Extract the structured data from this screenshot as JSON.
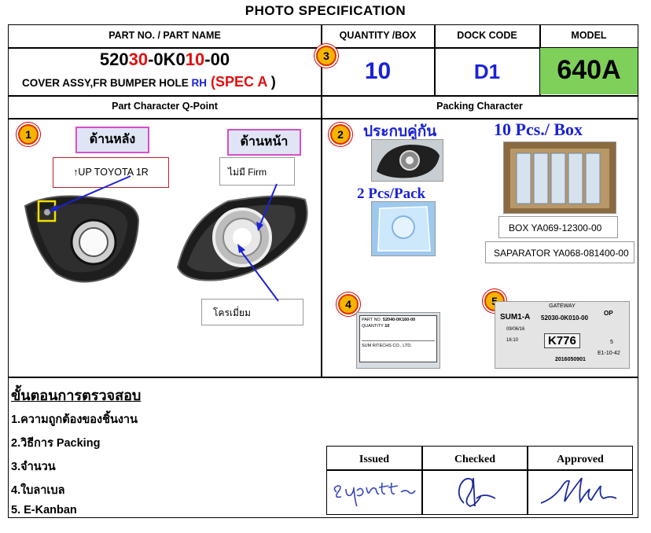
{
  "title": "PHOTO  SPECIFICATION",
  "header": {
    "part_label": "PART NO. / PART NAME",
    "qty_label": "QUANTITY /BOX",
    "dock_label": "DOCK CODE",
    "model_label": "MODEL"
  },
  "part": {
    "no_a": "520",
    "no_b": "30",
    "no_c": "-0K0",
    "no_d": "10",
    "no_e": "-00",
    "name": "COVER ASSY,FR BUMPER HOLE ",
    "side": "RH",
    "spec_open": " (",
    "spec": "SPEC A",
    "spec_close": " )"
  },
  "quantity": "10",
  "dock_code": "D1",
  "model": "640A",
  "model_bg": "#7ed05a",
  "sections": {
    "left": "Part Character Q-Point",
    "right": "Packing Character"
  },
  "badges": [
    "1",
    "2",
    "3",
    "4",
    "5"
  ],
  "q_point": {
    "back_label": "ด้านหลัง",
    "front_label": "ด้านหน้า",
    "note_up": "↑UP TOYOTA 1R",
    "note_firm": "ไม่มี Firm",
    "note_chrome": "โครเมี่ยม"
  },
  "packing": {
    "assembled": "ประกบคู่กัน",
    "pcs_box": "10 Pcs./ Box",
    "pcs_pack": "2 Pcs/Pack",
    "box_code": "BOX YA069-12300-00",
    "separator": "SAPARATOR  YA068-081400-00"
  },
  "label_card": {
    "part_no_label": "PART NO.",
    "part_no": "52040-0K160-00",
    "qty_label": "QUANTITY",
    "qty": "10",
    "company": "SUM RITECHS CO., LTD."
  },
  "kanban": {
    "gateway": "GATEWAY",
    "sum": "SUM1-A",
    "op": "OP",
    "part_no": "52030-0K010-00",
    "code": "K776",
    "date": "09/06/16",
    "time": "16:10",
    "qty": "5",
    "loc": "E1-10-42",
    "serial": "2016050901"
  },
  "steps": {
    "heading": "ขั้นตอนการตรวจสอบ",
    "items": [
      "1.ความถูกต้องของชิ้นงาน",
      "2.วิธีการ Packing",
      "3.จำนวน",
      "4.ใบลาเบล",
      "5. E-Kanban"
    ]
  },
  "signatures": {
    "issued": "Issued",
    "checked": "Checked",
    "approved": "Approved"
  }
}
